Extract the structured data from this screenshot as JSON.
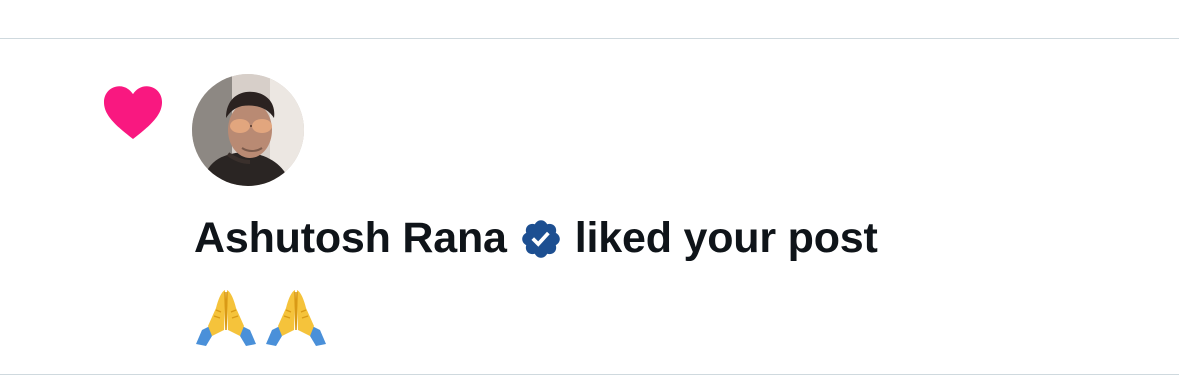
{
  "notification": {
    "type_icon": "heart-icon",
    "type_color": "#f91880",
    "avatar_icon": "avatar",
    "user_name": "Ashutosh Rana",
    "verified_icon": "verified-badge-icon",
    "verified_color": "#1d4f91",
    "action_text": "liked your post",
    "post_text": "🙏🙏",
    "post_emojis": [
      "pray-icon",
      "pray-icon"
    ]
  },
  "colors": {
    "text": "#0f1419",
    "divider": "#cfd9de",
    "background": "#ffffff"
  }
}
